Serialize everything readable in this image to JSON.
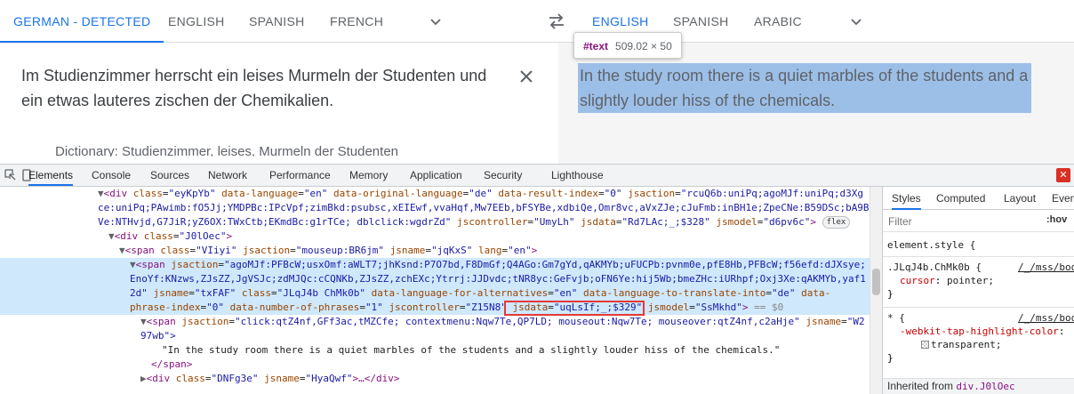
{
  "translate": {
    "source_tabs": [
      "GERMAN - DETECTED",
      "ENGLISH",
      "SPANISH",
      "FRENCH"
    ],
    "target_tabs": [
      "ENGLISH",
      "SPANISH",
      "ARABIC"
    ],
    "source_text": "Im Studienzimmer herrscht ein leises Murmeln der Studenten und ein etwas lauteres zischen der Chemikalien.",
    "partial_text": "Dictionary: Studienzimmer, leises, Murmeln der Studenten",
    "target_text": "In the study room there is a quiet marbles of the students and a slightly louder hiss of the chemicals.",
    "tooltip": {
      "tag": "#text",
      "dims": "509.02 × 50"
    },
    "icons": {
      "swap": "swap-languages-icon",
      "clear": "close-icon",
      "more": "chevron-down-icon"
    }
  },
  "devtools": {
    "tabs": [
      "Elements",
      "Console",
      "Sources",
      "Network",
      "Performance",
      "Memory",
      "Application",
      "Security",
      "Lighthouse"
    ],
    "elements": {
      "l1": {
        "tag_open": "<div ",
        "a1": "class",
        "v1": "\"eyKpYb\"",
        "a2": "data-language",
        "v2": "\"en\"",
        "a3": "data-original-language",
        "v3": "\"de\"",
        "a4": "data-result-index",
        "v4": "\"0\"",
        "a5": "jsaction",
        "v5": "\"rcuQ6b:uniPq;agoMJf:uniPq;d3Xg"
      },
      "l2": "ce:uniPq;PAwimb:fO5Jj;YMDPBc:IPcVpf;zimBkd:psubsc,xEIEwf,vvaHqf,Mw7EEb,bFSYBe,xdbiQe,Omr8vc,aVxZJe;cJuFmb:inBH1e;ZpeCNe:B59DSc;bA9B",
      "l3a": "Ve:NTHvjd,G7JiR;yZ6OX:TWxCtb;EKmdBc:g1rTCe; dblclick:wgdrZd\"",
      "l3b": {
        "a1": "jscontroller",
        "v1": "\"UmyLh\"",
        "a2": "jsdata",
        "v2": "\"Rd7LAc;_;$328\"",
        "a3": "jsmodel",
        "v3": "\"d6pv6c\"",
        "badge": "flex"
      },
      "l4": {
        "a1": "class",
        "v1": "\"J0lOec\""
      },
      "l5": {
        "a1": "class",
        "v1": "\"VIiyi\"",
        "a2": "jsaction",
        "v2": "\"mouseup:BR6jm\"",
        "a3": "jsname",
        "v3": "\"jqKxS\"",
        "a4": "lang",
        "v4": "\"en\""
      },
      "l6": {
        "a1": "jsaction",
        "v1": "\"agoMJf:PFBcW;usxOmf:aWLT7;jhKsnd:P7O7bd,F8DmGf;Q4AGo:Gm7gYd,qAKMYb;uFUCPb:pvnm0e,pfE8Hb,PFBcW;f56efd:dJXsye;"
      },
      "l7": "EnoYf:KNzws,ZJsZZ,JgVSJc;zdMJQc:cCQNKb,ZJsZZ,zchEXc;Ytrrj:JJDvdc;tNR8yc:GeFvjb;oFN6Ye:hij5Wb;bmeZHc:iURhpf;Oxj3Xe:qAKMYb,yaf1",
      "l8": {
        "pre": "2d\"",
        "a1": "jsname",
        "v1": "\"txFAF\"",
        "a2": "class",
        "v2": "\"JLqJ4b ChMk0b\"",
        "a3": "data-language-for-alternatives",
        "v3": "\"en\"",
        "a4": "data-language-to-translate-into",
        "v4": "\"de\"",
        "a5": "data-"
      },
      "l9": {
        "a0": "phrase-index",
        "v0": "\"0\"",
        "a1": "data-number-of-phrases",
        "v1": "\"1\"",
        "a2": "jscontroller",
        "v2": "\"Z15N8\"",
        "a3": "jsdata",
        "v3": "\"uqLsIf;_;$329\"",
        "a4": "jsmodel",
        "v4": "\"SsMkhd\"",
        "tail": " == $0"
      },
      "l10": {
        "a1": "jsaction",
        "v1": "\"click:qtZ4nf,GFf3ac,tMZCfe; contextmenu:Nqw7Te,QP7LD; mouseout:Nqw7Te; mouseover:qtZ4nf,c2aHje\"",
        "a2": "jsname",
        "v2": "\"W2"
      },
      "l11": "97wb\">",
      "l12": "\"In the study room there is a quiet marbles of the students and a slightly louder hiss of the chemicals.\"",
      "l13": "</span>",
      "l14": {
        "a1": "class",
        "v1": "\"DNFg3e\"",
        "a2": "jsname",
        "v2": "\"HyaQwf\"",
        "rest": "…</div>"
      }
    },
    "styles": {
      "tabs": [
        "Styles",
        "Computed",
        "Layout",
        "Event"
      ],
      "filter_placeholder": "Filter",
      "hov": ":hov",
      "element_style": "element.style {",
      "rule1": {
        "selector": ".JLqJ4b.ChMk0b {",
        "link": "/_/mss/boq",
        "prop": "cursor",
        "val": "pointer;"
      },
      "rule2": {
        "selector": "* {",
        "link": "/_/mss/boq",
        "prop": "-webkit-tap-highlight-color",
        "val": "transparent;"
      },
      "close": "}",
      "inherited_label": "Inherited from",
      "inherited_sel": "div.J0lOec"
    }
  }
}
